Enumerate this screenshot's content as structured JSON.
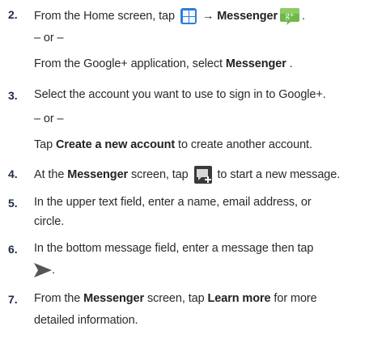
{
  "steps": [
    {
      "num": "2.",
      "l1_pre": "From the Home screen, tap ",
      "l1_arrow": " → ",
      "l1_bold": "Messenger",
      "l1_post": ".",
      "or": "– or –",
      "l3_pre": "From the Google+ application, select ",
      "l3_bold": "Messenger",
      "l3_post": " ."
    },
    {
      "num": "3.",
      "l1": "Select the account you want to use to sign in to Google+.",
      "or": "– or –",
      "l3_pre": "Tap ",
      "l3_bold": "Create a new account",
      "l3_post": " to create another account."
    },
    {
      "num": "4.",
      "l1_pre": "At the ",
      "l1_bold": "Messenger",
      "l1_mid": " screen, tap ",
      "l1_post": " to start a new message."
    },
    {
      "num": "5.",
      "l1": "In the upper text field, enter a name, email address, or",
      "l2": "circle."
    },
    {
      "num": "6.",
      "l1": "In the bottom message field, enter a message then tap",
      "l2_post": "."
    },
    {
      "num": "7.",
      "l1_pre": "From the ",
      "l1_bold": "Messenger",
      "l1_mid": " screen, tap ",
      "l1_bold2": "Learn more",
      "l1_post": " for more",
      "l2": "detailed information."
    }
  ],
  "icons": {
    "apps": "apps-grid-icon",
    "messenger": "google-plus-messenger-icon",
    "compose": "new-message-icon",
    "send": "send-icon"
  },
  "colors": {
    "apps_blue": "#2e7fd6",
    "messenger_green": "#6fb84a",
    "text": "#2a2a2a",
    "step_number": "#1f2a4a"
  }
}
